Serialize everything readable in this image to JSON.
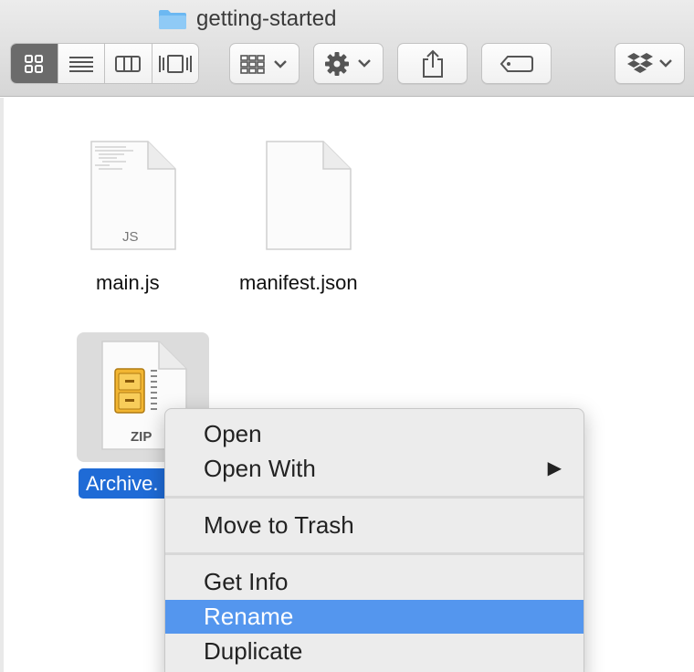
{
  "window": {
    "title": "getting-started",
    "folder_color": "#6cb8f2"
  },
  "toolbar": {
    "view_modes": [
      "icon-view",
      "list-view",
      "column-view",
      "cover-flow-view"
    ],
    "active_view": "icon-view",
    "buttons": [
      "arrange",
      "action",
      "share",
      "tags",
      "dropbox"
    ]
  },
  "files": [
    {
      "name": "main.js",
      "type_label": "JS"
    },
    {
      "name": "manifest.json",
      "type_label": ""
    },
    {
      "name": "Archive.",
      "type_label": "ZIP",
      "selected": true
    }
  ],
  "context_menu": {
    "items": [
      {
        "label": "Open",
        "submenu": false
      },
      {
        "label": "Open With",
        "submenu": true
      },
      {
        "label": "Move to Trash",
        "submenu": false
      },
      {
        "label": "Get Info",
        "submenu": false
      },
      {
        "label": "Rename",
        "submenu": false,
        "highlighted": true
      },
      {
        "label": "Duplicate",
        "submenu": false
      }
    ],
    "highlight_color": "#5496ee"
  },
  "selection_color": "#1f6bd6"
}
